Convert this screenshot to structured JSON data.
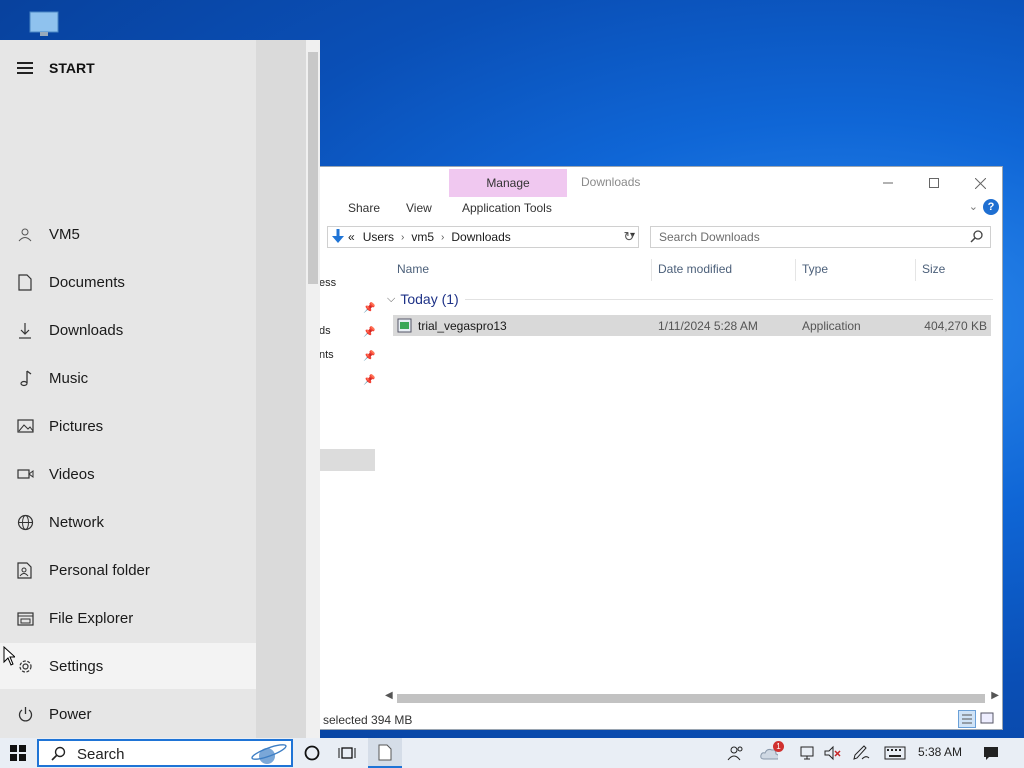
{
  "start_menu": {
    "title": "START",
    "items": [
      {
        "label": "VM5",
        "icon": "user-icon"
      },
      {
        "label": "Documents",
        "icon": "document-icon"
      },
      {
        "label": "Downloads",
        "icon": "download-icon"
      },
      {
        "label": "Music",
        "icon": "music-note-icon"
      },
      {
        "label": "Pictures",
        "icon": "picture-icon"
      },
      {
        "label": "Videos",
        "icon": "video-camera-icon"
      },
      {
        "label": "Network",
        "icon": "globe-icon"
      },
      {
        "label": "Personal folder",
        "icon": "personal-folder-icon"
      },
      {
        "label": "File Explorer",
        "icon": "file-explorer-icon"
      },
      {
        "label": "Settings",
        "icon": "gear-icon"
      },
      {
        "label": "Power",
        "icon": "power-icon"
      }
    ]
  },
  "explorer": {
    "contextual_tab": "Manage",
    "window_title": "Downloads",
    "ribbon_tabs": [
      "Share",
      "View",
      "Application Tools"
    ],
    "address": {
      "overflow": "«",
      "segments": [
        "Users",
        "vm5",
        "Downloads"
      ]
    },
    "search_placeholder": "Search Downloads",
    "nav_fragments": [
      "ess",
      "ds",
      "nts"
    ],
    "columns": [
      "Name",
      "Date modified",
      "Type",
      "Size"
    ],
    "group_header": "Today (1)",
    "files": [
      {
        "name": "trial_vegaspro13",
        "date": "1/11/2024 5:28 AM",
        "type": "Application",
        "size": "404,270 KB"
      }
    ],
    "status_text": "selected  394 MB"
  },
  "taskbar": {
    "search_text": "Search",
    "clock": "5:38 AM",
    "notification_badge": "1"
  }
}
